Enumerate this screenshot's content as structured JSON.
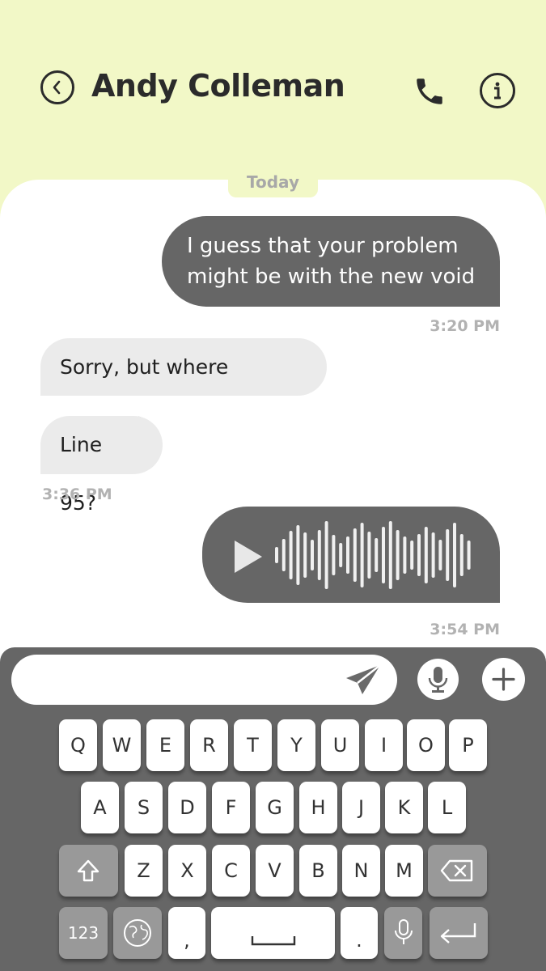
{
  "header": {
    "contact_name": "Andy Colleman",
    "back_icon": "chevron-left-circle-icon",
    "call_icon": "phone-icon",
    "info_icon": "info-icon"
  },
  "chat": {
    "date_label": "Today",
    "messages": [
      {
        "direction": "outgoing",
        "text": "I guess that your problem might be with the new void",
        "time": "3:20 PM"
      },
      {
        "direction": "incoming",
        "text": "Sorry, but where exactly?"
      },
      {
        "direction": "incoming",
        "text": "Line 95?",
        "time": "3:36 PM"
      },
      {
        "direction": "outgoing",
        "type": "voice",
        "icon": "play-icon",
        "time": "3:54 PM"
      }
    ]
  },
  "composer": {
    "input_value": "",
    "send_icon": "send-icon",
    "mic_icon": "microphone-icon",
    "add_icon": "plus-icon"
  },
  "keyboard": {
    "row1": [
      "Q",
      "W",
      "E",
      "R",
      "T",
      "Y",
      "U",
      "I",
      "O",
      "P"
    ],
    "row2": [
      "A",
      "S",
      "D",
      "F",
      "G",
      "H",
      "J",
      "K",
      "L"
    ],
    "row3": [
      "Z",
      "X",
      "C",
      "V",
      "B",
      "N",
      "M"
    ],
    "numbers_label": "123",
    "comma": ",",
    "period": ".",
    "icons": [
      "shift-icon",
      "backspace-icon",
      "globe-icon",
      "space-icon",
      "microphone-icon",
      "return-icon"
    ]
  },
  "colors": {
    "header_bg": "#f2f8c7",
    "outgoing_bubble": "#666666",
    "incoming_bubble": "#ebebeb",
    "keyboard_bg": "#666666"
  }
}
